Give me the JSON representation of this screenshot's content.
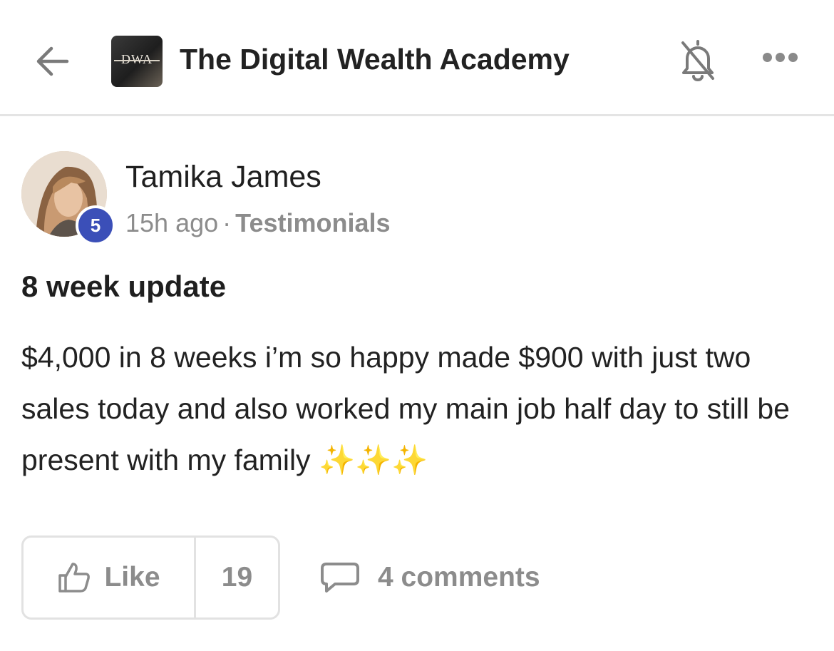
{
  "header": {
    "group_logo_text": "DWA",
    "group_name": "The Digital Wealth Academy",
    "icons": {
      "back": "arrow-left-icon",
      "bell": "bell-off-icon",
      "more": "more-horizontal-icon"
    }
  },
  "post": {
    "author": {
      "name": "Tamika James",
      "level": "5"
    },
    "time": "15h ago",
    "separator": "·",
    "category": "Testimonials",
    "title": "8 week update",
    "body": "$4,000 in 8 weeks i’m so happy made $900 with just two sales today and also worked my main job half day to still be present with my family ✨✨✨"
  },
  "actions": {
    "like_label": "Like",
    "like_count": "19",
    "comments_label": "4 comments",
    "icons": {
      "like": "thumbs-up-icon",
      "comment": "comment-bubble-icon"
    }
  },
  "colors": {
    "badge": "#3b4fb8",
    "text": "#1f1f1f",
    "muted": "#8c8c8c",
    "border": "#e2e2e2"
  }
}
